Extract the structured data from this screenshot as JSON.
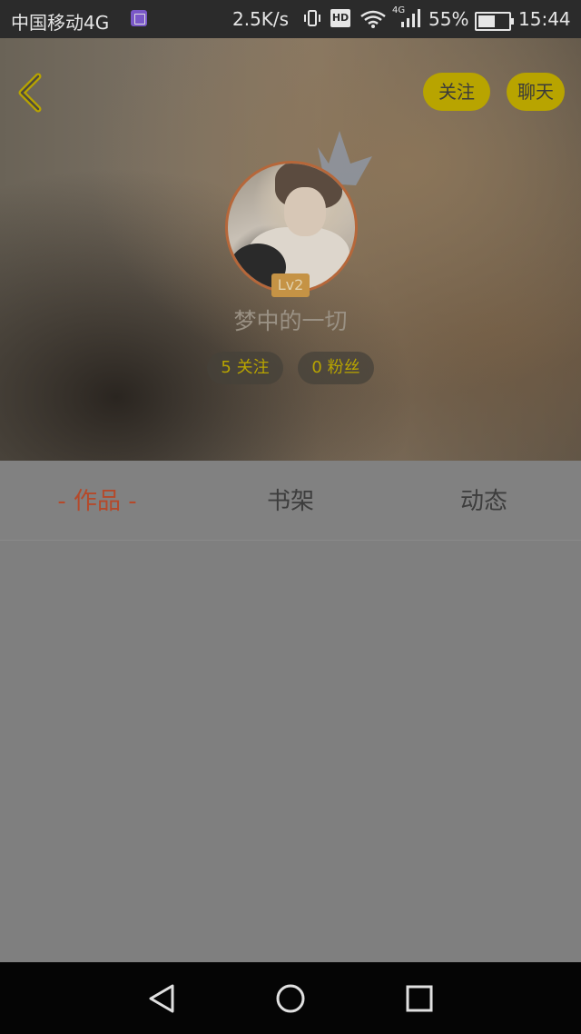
{
  "status_bar": {
    "carrier": "中国移动4G",
    "network_speed": "2.5K/s",
    "hd_label": "HD",
    "signal_label": "4G",
    "battery_percent": "55%",
    "time": "15:44"
  },
  "header": {
    "back_icon": "chevron-left-icon",
    "follow_label": "关注",
    "chat_label": "聊天",
    "level": "Lv2",
    "username": "梦中的一切",
    "following_count": "5 关注",
    "fans_count": "0 粉丝"
  },
  "tabs": [
    {
      "label": "- 作品 -",
      "active": true
    },
    {
      "label": "书架",
      "active": false
    },
    {
      "label": "动态",
      "active": false
    }
  ],
  "colors": {
    "accent": "#b5492a",
    "pill": "#b8a400",
    "level_badge": "#c59345"
  },
  "navbar": {
    "back_icon": "triangle-back-icon",
    "home_icon": "circle-home-icon",
    "recent_icon": "square-recent-icon"
  }
}
